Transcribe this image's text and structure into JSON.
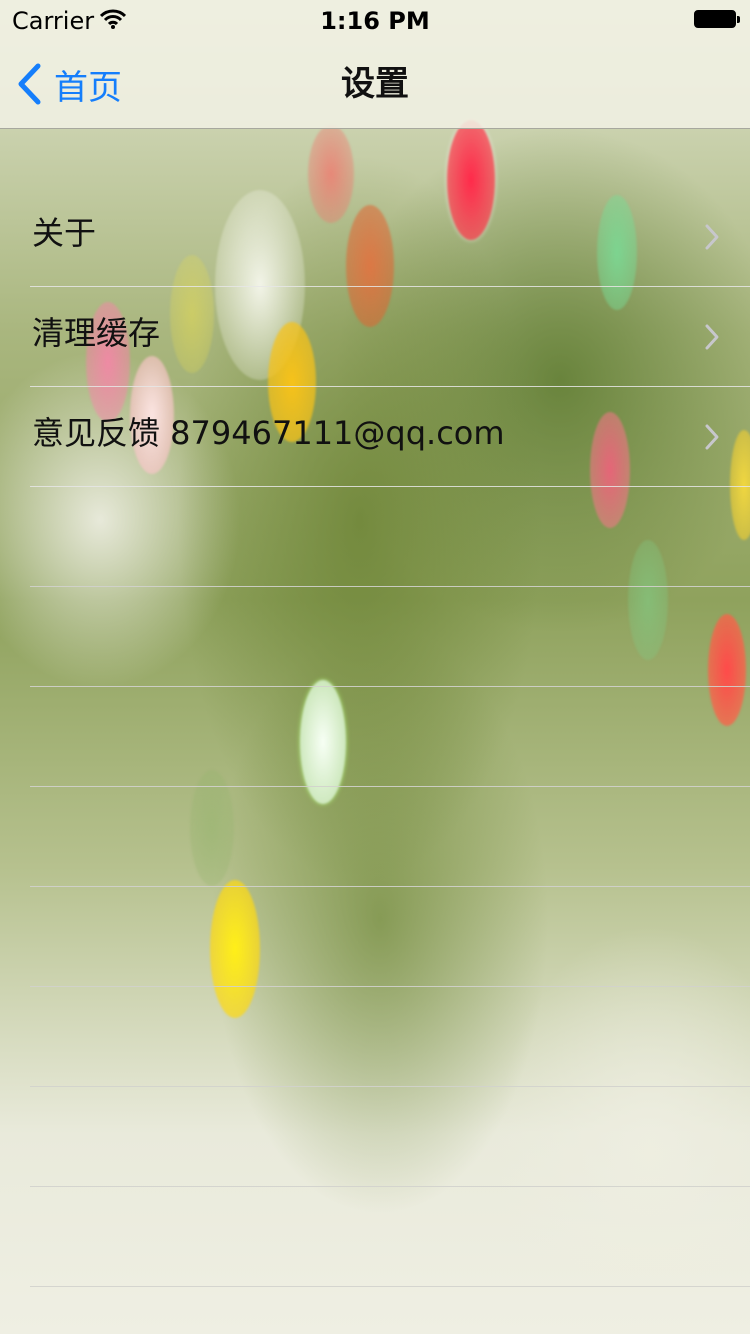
{
  "status_bar": {
    "carrier": "Carrier",
    "time": "1:16 PM",
    "wifi_icon": "wifi-icon",
    "battery_icon": "battery-icon"
  },
  "nav_bar": {
    "back_label": "首页",
    "title": "设置",
    "back_icon": "chevron-left-icon",
    "accent_color": "#157efb"
  },
  "settings": {
    "items": [
      {
        "label": "关于",
        "icon": "chevron-right-icon"
      },
      {
        "label": "清理缓存",
        "icon": "chevron-right-icon"
      },
      {
        "label": "意见反馈 879467111@qq.com",
        "icon": "chevron-right-icon"
      }
    ],
    "empty_row_count": 8
  }
}
